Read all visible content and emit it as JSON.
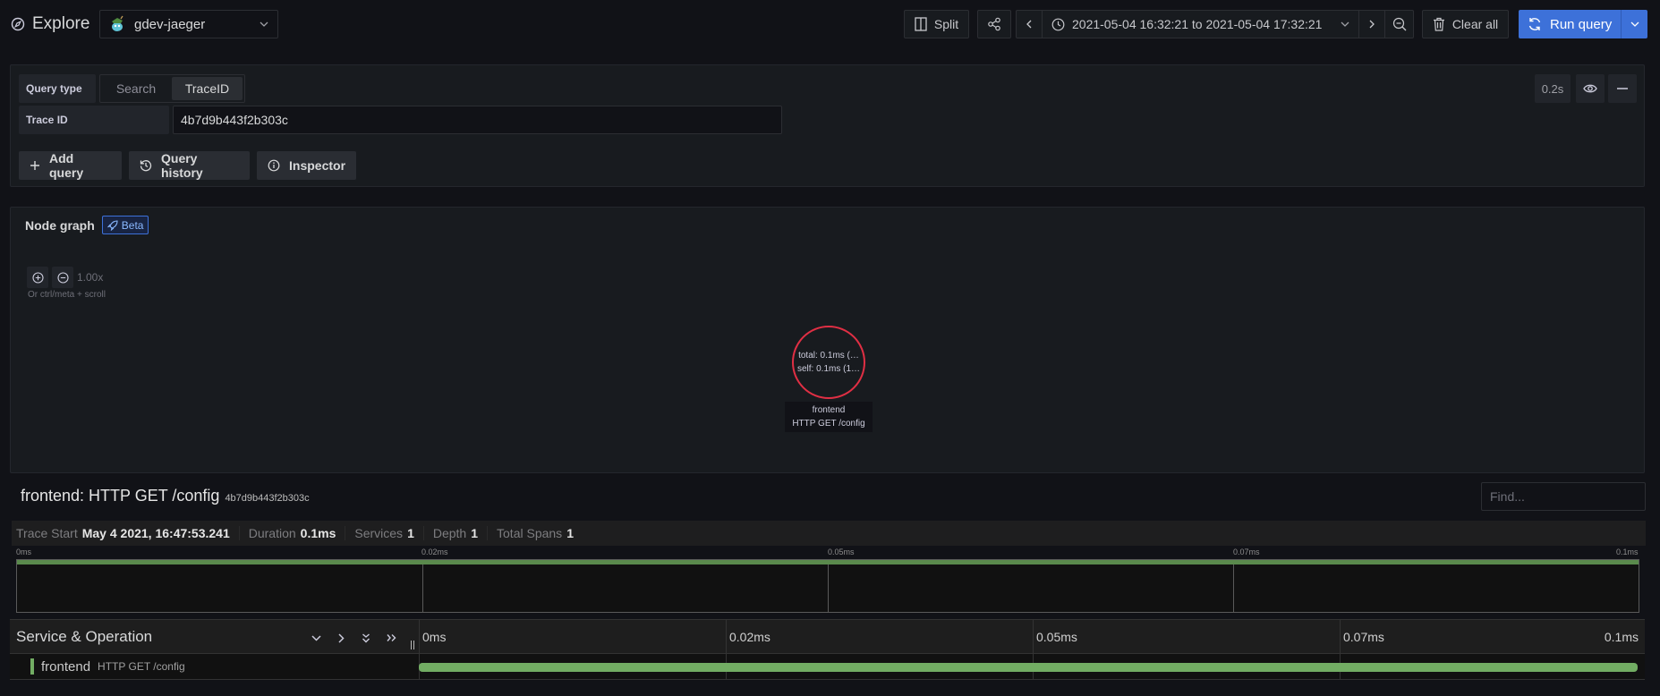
{
  "app": {
    "title": "Explore",
    "datasource": "gdev-jaeger"
  },
  "toolbar": {
    "split_label": "Split",
    "time_range": "2021-05-04 16:32:21 to 2021-05-04 17:32:21",
    "clear_all_label": "Clear all",
    "run_query_label": "Run query"
  },
  "query": {
    "query_type_label": "Query type",
    "query_types": [
      {
        "label": "Search",
        "active": false
      },
      {
        "label": "TraceID",
        "active": true
      }
    ],
    "trace_id_label": "Trace ID",
    "trace_id_value": "4b7d9b443f2b303c",
    "query_time": "0.2s",
    "add_query_label": "Add query",
    "query_history_label": "Query history",
    "inspector_label": "Inspector"
  },
  "node_graph": {
    "title": "Node graph",
    "badge": "Beta",
    "zoom_level": "1.00x",
    "zoom_hint": "Or ctrl/meta + scroll",
    "node": {
      "stat_total": "total: 0.1ms (…",
      "stat_self": "self: 0.1ms (1…",
      "service": "frontend",
      "operation": "HTTP GET /config",
      "ring_color": "#e02f44"
    }
  },
  "trace": {
    "title": "frontend: HTTP GET /config",
    "trace_id": "4b7d9b443f2b303c",
    "find_placeholder": "Find...",
    "meta": [
      {
        "key": "Trace Start",
        "value": "May 4 2021, 16:47:53.241"
      },
      {
        "key": "Duration",
        "value": "0.1ms"
      },
      {
        "key": "Services",
        "value": "1"
      },
      {
        "key": "Depth",
        "value": "1"
      },
      {
        "key": "Total Spans",
        "value": "1"
      }
    ],
    "minimap_ticks": [
      "0ms",
      "0.02ms",
      "0.05ms",
      "0.07ms",
      "0.1ms"
    ],
    "timeline_header": "Service & Operation",
    "timeline_ticks": [
      "0ms",
      "0.02ms",
      "0.05ms",
      "0.07ms",
      "0.1ms"
    ],
    "spans": [
      {
        "service": "frontend",
        "operation": "HTTP GET /config",
        "color": "#72ad63",
        "start_fraction": 0.0,
        "end_fraction": 1.0
      }
    ]
  }
}
